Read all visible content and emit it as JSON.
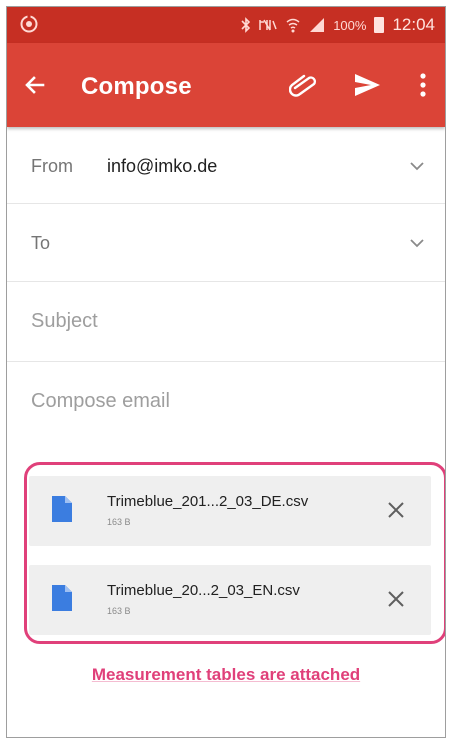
{
  "colors": {
    "status_bar": "#c62f23",
    "app_bar": "#db4437",
    "highlight": "#e0407a",
    "file_icon": "#3b7de0"
  },
  "status_bar": {
    "left_icon": "circle-notification-icon",
    "icons": [
      "bluetooth-icon",
      "mute-icon",
      "wifi-icon",
      "signal-icon"
    ],
    "battery_percent": "100%",
    "time": "12:04"
  },
  "app_bar": {
    "back_icon": "arrow-left-icon",
    "title": "Compose",
    "attach_icon": "paperclip-icon",
    "send_icon": "send-icon",
    "more_icon": "more-vertical-icon"
  },
  "form": {
    "from_label": "From",
    "from_value": "info@imko.de",
    "to_label": "To",
    "subject_placeholder": "Subject",
    "body_placeholder": "Compose email"
  },
  "attachments": [
    {
      "name": "Trimeblue_201...2_03_DE.csv",
      "size": "163 B"
    },
    {
      "name": "Trimeblue_20...2_03_EN.csv",
      "size": "163 B"
    }
  ],
  "annotation": "Measurement tables are attached"
}
